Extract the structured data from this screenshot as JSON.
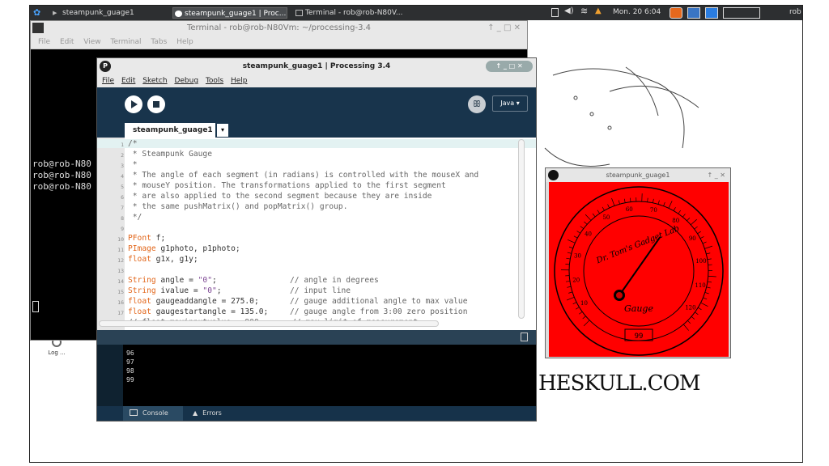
{
  "taskbar": {
    "tasks": [
      "steampunk_guage1",
      "steampunk_guage1 | Proc...",
      "Terminal - rob@rob-N80V..."
    ],
    "clock": "Mon. 20  6:04",
    "user": "rob"
  },
  "terminal": {
    "title": "Terminal - rob@rob-N80Vm: ~/processing-3.4",
    "menu": [
      "File",
      "Edit",
      "View",
      "Terminal",
      "Tabs",
      "Help"
    ],
    "lines": [
      "rob@rob-N80",
      "rob@rob-N80",
      "rob@rob-N80"
    ]
  },
  "processing": {
    "title": "steampunk_guage1 | Processing 3.4",
    "menu": [
      "File",
      "Edit",
      "Sketch",
      "Debug",
      "Tools",
      "Help"
    ],
    "mode": "Java ▾",
    "tab": "steampunk_guage1",
    "console_tab": "Console",
    "errors_tab": "Errors",
    "console_lines": [
      "96",
      "97",
      "98",
      "99"
    ],
    "code": {
      "l1": "/*",
      "l2": " * Steampunk Gauge",
      "l3": " *",
      "l4": " * The angle of each segment (in radians) is controlled with the mouseX and",
      "l5": " * mouseY position. The transformations applied to the first segment",
      "l6": " * are also applied to the second segment because they are inside",
      "l7": " * the same pushMatrix() and popMatrix() group.",
      "l8": " */",
      "l10_kw": "PFont",
      "l10_rest": " f;",
      "l11_kw": "PImage",
      "l11_rest": " g1photo, p1photo;",
      "l12_kw": "float",
      "l12_rest": " g1x, g1y;",
      "l14_kw": "String",
      "l14_a": " angle = ",
      "l14_str": "\"0\"",
      "l14_b": ";",
      "l14_cm": "// angle in degrees",
      "l15_kw": "String",
      "l15_a": " ivalue = ",
      "l15_str": "\"0\"",
      "l15_b": ";",
      "l15_cm": "// input line",
      "l16_kw": "float",
      "l16_a": " gaugeaddangle = 275.0;",
      "l16_cm": "// gauge additional angle to max value",
      "l17_kw": "float",
      "l17_a": " gaugestartangle = 135.0;",
      "l17_cm": "// gauge angle from 3:00 zero position",
      "l18": "// float maxinputvalue = 900;      // max limit of measurement",
      "l19_kw": "float",
      "l19_a": " maxinputvalue = 157.5;",
      "l19_cm": "// max limit of measurement"
    }
  },
  "gauge": {
    "title": "steampunk_guage1",
    "brand": "Dr. Tom's Gadget Lab",
    "word": "Gauge",
    "readout": "99",
    "ticks": [
      "10",
      "20",
      "30",
      "40",
      "50",
      "60",
      "70",
      "80",
      "90",
      "100",
      "110",
      "120"
    ],
    "needle_value": 99,
    "scale_max": 157.5
  },
  "desktop": {
    "logout": "Log ...",
    "watermark": "HESKULL.COM"
  }
}
